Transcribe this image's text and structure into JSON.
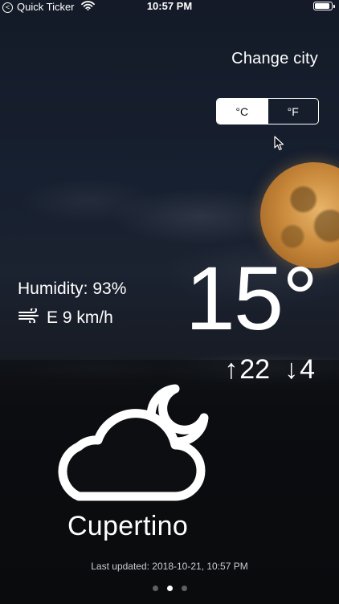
{
  "status_bar": {
    "back_glyph": "<",
    "app_name": "Quick Ticker",
    "time": "10:57 PM",
    "battery_level": 0.9
  },
  "header": {
    "change_city_label": "Change city"
  },
  "units": {
    "celsius_label": "°C",
    "fahrenheit_label": "°F",
    "selected": "celsius"
  },
  "conditions": {
    "humidity": "Humidity: 93%",
    "wind": "E 9 km/h",
    "temperature": "15°",
    "high_arrow": "↑",
    "high": "22",
    "low_arrow": "↓",
    "low": "4"
  },
  "location": {
    "city": "Cupertino"
  },
  "footer": {
    "last_updated": "Last updated: 2018-10-21, 10:57 PM",
    "page_count": 3,
    "current_page": 2
  },
  "icons": {
    "weather": "cloud-moon-icon",
    "wind": "wind-icon",
    "wifi": "wifi-icon",
    "battery": "battery-icon",
    "cursor": "mouse-pointer-icon"
  },
  "colors": {
    "text": "#ffffff",
    "segment_selected_bg": "#ffffff",
    "segment_selected_text": "#111318",
    "moon": "#e8b46a"
  }
}
